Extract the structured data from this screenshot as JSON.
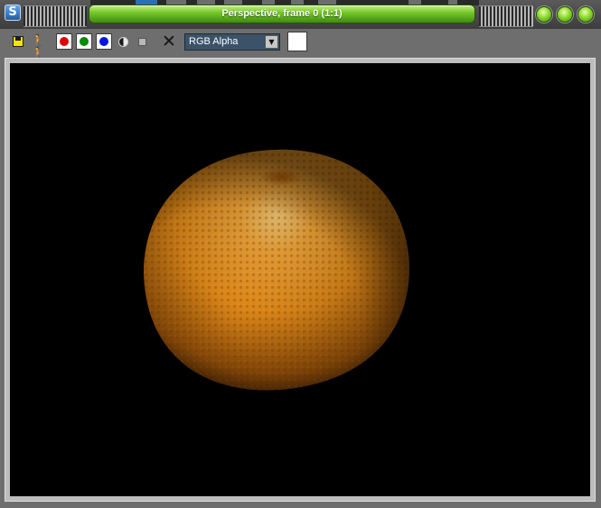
{
  "window": {
    "title": "Perspective, frame 0 (1:1)",
    "app_icon_glyph": "S",
    "title_bar_color": "#76c829"
  },
  "toolbar": {
    "save_icon": "save-image-icon",
    "clone_icon": "clone-window-icon",
    "channels": [
      {
        "name": "red",
        "color": "#e00000"
      },
      {
        "name": "green",
        "color": "#008a00"
      },
      {
        "name": "blue",
        "color": "#0016e0"
      }
    ],
    "channel_display": {
      "value": "RGB Alpha"
    },
    "swatch_color": "#ffffff"
  },
  "viewport": {
    "background": "#000000",
    "subject": "orange-render"
  }
}
